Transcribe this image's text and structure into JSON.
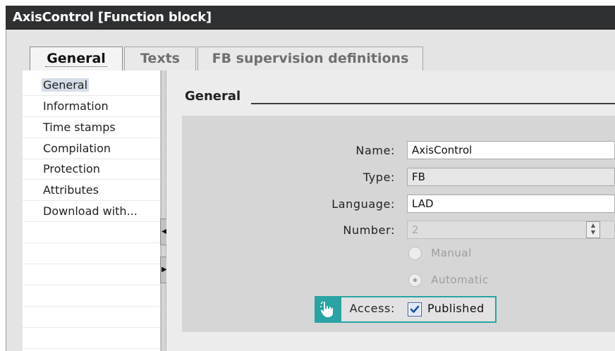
{
  "window": {
    "title": "AxisControl [Function block]"
  },
  "tabs": [
    {
      "label": "General",
      "active": true
    },
    {
      "label": "Texts",
      "active": false
    },
    {
      "label": "FB supervision definitions",
      "active": false
    }
  ],
  "nav": {
    "items": [
      {
        "label": "General",
        "selected": true
      },
      {
        "label": "Information"
      },
      {
        "label": "Time stamps"
      },
      {
        "label": "Compilation"
      },
      {
        "label": "Protection"
      },
      {
        "label": "Attributes"
      },
      {
        "label": "Download with..."
      }
    ]
  },
  "section": {
    "title": "General"
  },
  "form": {
    "name": {
      "label": "Name:",
      "value": "AxisControl"
    },
    "type": {
      "label": "Type:",
      "value": "FB"
    },
    "language": {
      "label": "Language:",
      "value": "LAD"
    },
    "number": {
      "label": "Number:",
      "value": "2"
    },
    "manual": {
      "label": "Manual",
      "checked": false
    },
    "automatic": {
      "label": "Automatic",
      "checked": true
    },
    "access": {
      "label": "Access:",
      "option": "Published",
      "checked": true
    }
  },
  "colors": {
    "titlebar": "#2f3032",
    "highlight": "#29a3a3",
    "checkbox_accent": "#3b5f9a"
  },
  "icons": {
    "hint": "pointing-hand-icon",
    "collapse": "chevron-left-icon",
    "expand": "chevron-right-icon",
    "stepper": "spin-up-down-icon"
  }
}
